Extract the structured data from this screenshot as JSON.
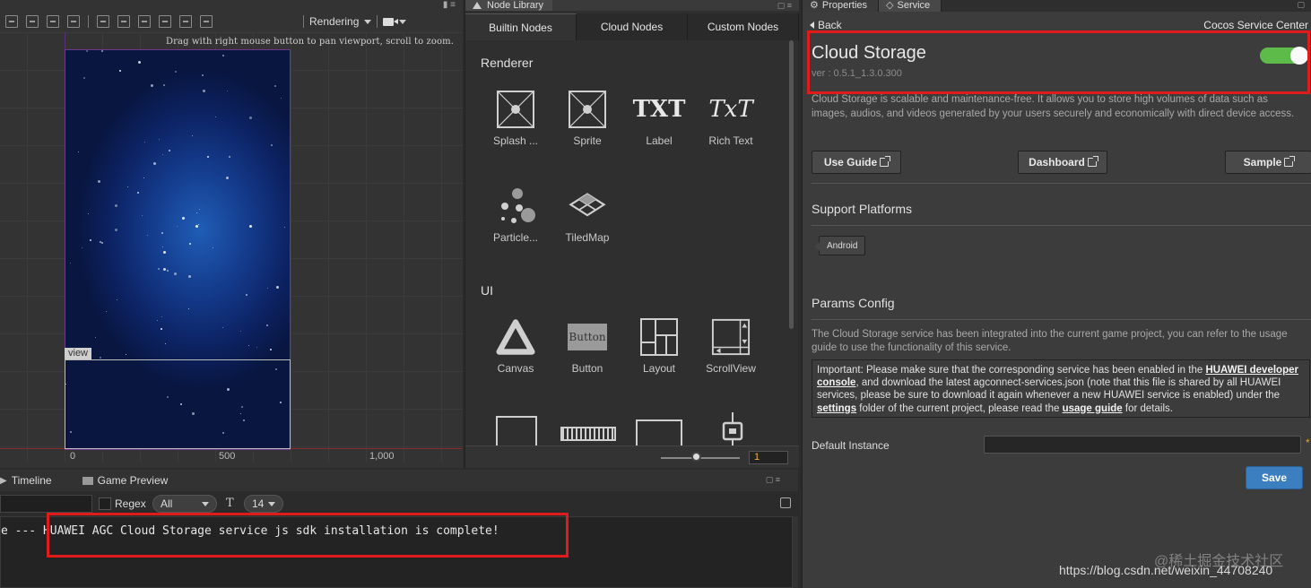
{
  "scene": {
    "rendering_label": "Rendering",
    "hint": "Drag with right mouse button to pan viewport, scroll to zoom.",
    "view_tag": "view",
    "axis_labels": [
      "0",
      "500",
      "1,000"
    ]
  },
  "node_library": {
    "title": "Node Library",
    "tabs": [
      "Builtin Nodes",
      "Cloud Nodes",
      "Custom Nodes"
    ],
    "sections": {
      "renderer": {
        "title": "Renderer",
        "items": [
          "Splash ...",
          "Sprite",
          "Label",
          "Rich Text",
          "Particle...",
          "TiledMap"
        ]
      },
      "ui": {
        "title": "UI",
        "items": [
          "Canvas",
          "Button",
          "Layout",
          "ScrollView"
        ]
      }
    },
    "icon_texts": {
      "label": "TXT",
      "rich_text": "TxT",
      "button": "Button"
    },
    "zoom_value": "1"
  },
  "console": {
    "tabs": [
      "Timeline",
      "Game Preview"
    ],
    "regex_label": "Regex",
    "level_dropdown": "All",
    "font_size_dropdown": "14",
    "log_line": "e --- HUAWEI AGC Cloud Storage service js sdk installation is complete!"
  },
  "service_panel": {
    "tabs": [
      "Properties",
      "Service"
    ],
    "back_label": "Back",
    "center_label": "Cocos Service Center",
    "service_name": "Cloud Storage",
    "version": "ver : 0.5.1_1.3.0.300",
    "enabled": true,
    "description": "Cloud Storage is scalable and maintenance-free. It allows you to store high volumes of data such as images,  audios,  and videos generated by your users securely and economically with direct device access.",
    "buttons": [
      "Use Guide",
      "Dashboard",
      "Sample"
    ],
    "support_platforms_title": "Support Platforms",
    "platforms": [
      "Android"
    ],
    "params_title": "Params Config",
    "params_intro": "The Cloud Storage service has been integrated into the current game project, you can refer to the usage guide to use the functionality of this service.",
    "important": {
      "t1": "Important: Please make sure that the corresponding service has been enabled in the ",
      "link1": "HUAWEI developer console",
      "t2": ", and download the latest agconnect-services.json (note that this file is shared by all HUAWEI services, please be sure to download it again whenever a new HUAWEI service is enabled) under the ",
      "link2": "settings",
      "t3": " folder of the current project, please read the ",
      "link3": "usage guide",
      "t4": " for details."
    },
    "default_instance_label": "Default Instance",
    "default_instance_value": "",
    "required_mark": "*",
    "save_label": "Save"
  },
  "watermarks": [
    "@稀土掘金技术社区",
    "https://blog.csdn.net/weixin_44708240"
  ],
  "colors": {
    "accent_blue": "#3c7fc0",
    "toggle_green": "#5dbb4a",
    "highlight_red": "#e01b1b"
  }
}
